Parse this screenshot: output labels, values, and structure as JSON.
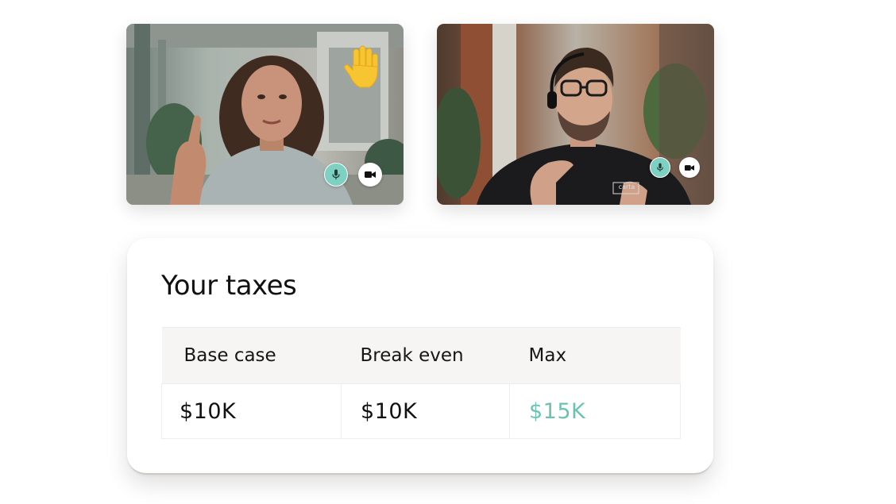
{
  "participants": [
    {
      "raised_hand": true,
      "mic_icon": "microphone-icon",
      "camera_icon": "video-camera-icon"
    },
    {
      "raised_hand": false,
      "mic_icon": "microphone-icon",
      "camera_icon": "video-camera-icon",
      "shirt_text": "carta"
    }
  ],
  "taxes": {
    "title": "Your taxes",
    "columns": [
      "Base case",
      "Break even",
      "Max"
    ],
    "values": [
      "$10K",
      "$10K",
      "$15K"
    ]
  },
  "colors": {
    "accent": "#6cc3b2",
    "mic_active": "#7ed1c2",
    "hand": "#f7c531"
  }
}
